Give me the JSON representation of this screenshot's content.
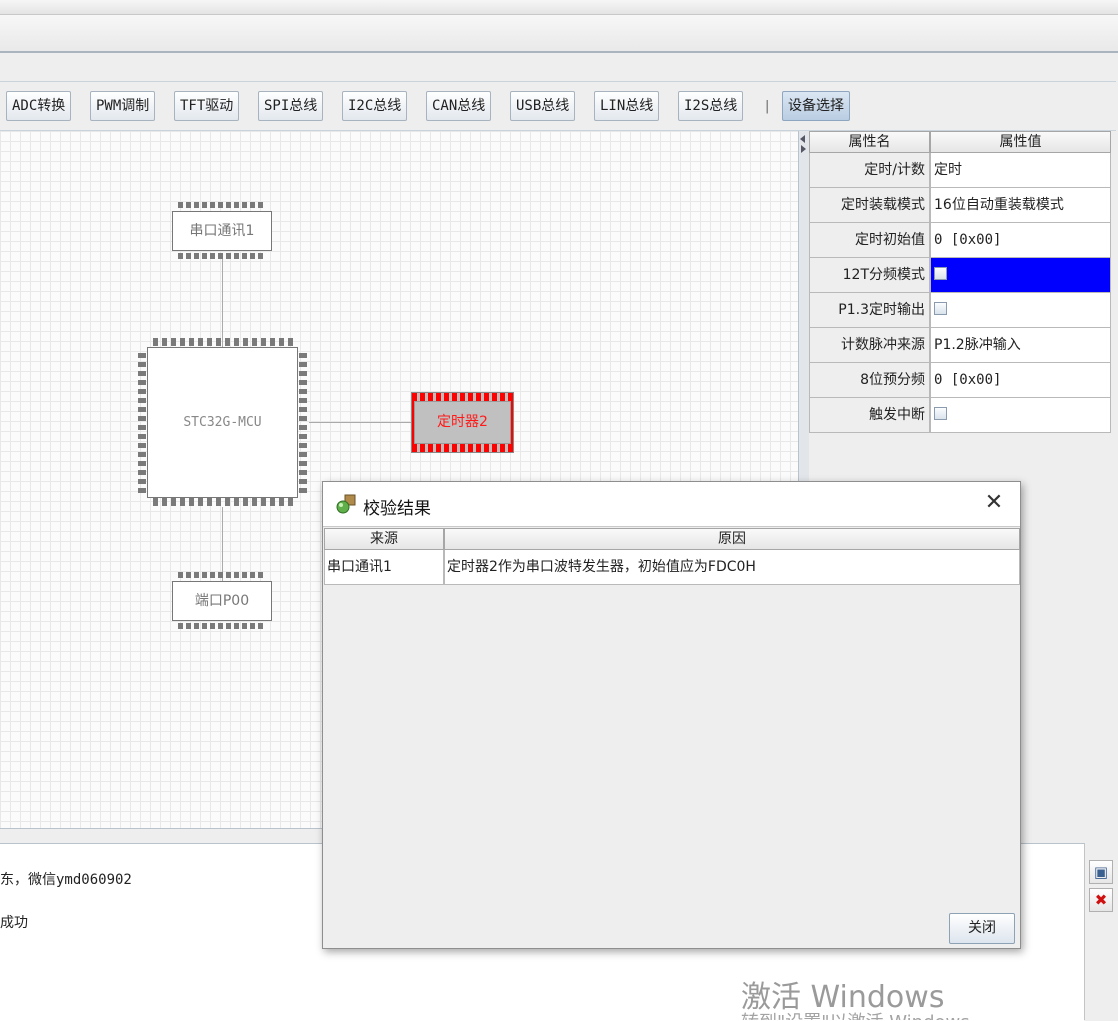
{
  "toolbar": {
    "buttons": [
      "ADC转换",
      "PWM调制",
      "TFT驱动",
      "SPI总线",
      "I2C总线",
      "CAN总线",
      "USB总线",
      "LIN总线",
      "I2S总线"
    ],
    "separator": "|",
    "device_select": "设备选择"
  },
  "canvas": {
    "chip_uart": "串口通讯1",
    "chip_mcu": "STC32G-MCU",
    "chip_timer": "定时器2",
    "chip_port": "端口P00",
    "timer_highlight_color": "#ff0000"
  },
  "properties": {
    "header_name": "属性名",
    "header_value": "属性值",
    "rows": [
      {
        "name": "定时/计数",
        "value": "定时"
      },
      {
        "name": "定时装载模式",
        "value": "16位自动重装载模式"
      },
      {
        "name": "定时初始值",
        "value": "0 [0x00]"
      },
      {
        "name": "12T分频模式",
        "value": ""
      },
      {
        "name": "P1.3定时输出",
        "value": ""
      },
      {
        "name": "计数脉冲来源",
        "value": "P1.2脉冲输入"
      },
      {
        "name": "8位预分频",
        "value": "0 [0x00]"
      },
      {
        "name": "触发中断",
        "value": ""
      }
    ]
  },
  "log": {
    "line1": "东，微信ymd060902",
    "line2": "成功"
  },
  "watermark": {
    "line1": "激活 Windows",
    "line2": "转到\"设置\"以激活 Windows。"
  },
  "dialog": {
    "title": "校验结果",
    "col_source": "来源",
    "col_reason": "原因",
    "rows": [
      {
        "source": "串口通讯1",
        "reason": "定时器2作为串口波特发生器，初始值应为FDC0H"
      }
    ],
    "close_label": "关闭"
  }
}
